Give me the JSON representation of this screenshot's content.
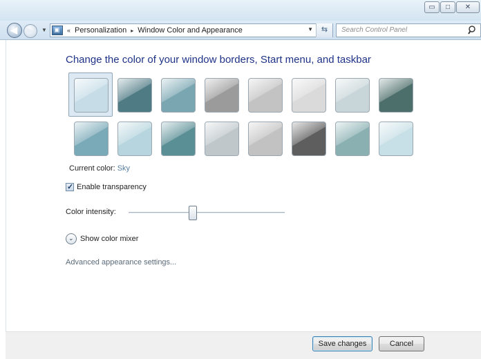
{
  "window": {
    "caption_buttons": {
      "minimize": "minimize-icon",
      "maximize": "maximize-icon",
      "close": "close-icon"
    }
  },
  "navbar": {
    "address": {
      "icon": "control-panel-icon",
      "overflow_glyph": "«",
      "separator_glyph": "▸",
      "breadcrumbs": [
        "Personalization",
        "Window Color and Appearance"
      ]
    },
    "search": {
      "placeholder": "Search Control Panel"
    }
  },
  "main": {
    "heading": "Change the color of your window borders, Start menu, and taskbar",
    "swatches": [
      [
        "#c6dde8",
        "#4f7b85",
        "#7aa6b2",
        "#9b9b9b",
        "#c3c3c3",
        "#dadada",
        "#c9d6d9",
        "#4d6f6b"
      ],
      [
        "#7aa9b8",
        "#b6d5de",
        "#5a8f96",
        "#bfc7cb",
        "#c2c2c2",
        "#5e5e5e",
        "#8ab0b2",
        "#c7dfe6"
      ]
    ],
    "selected_swatch": {
      "row": 0,
      "col": 0
    },
    "current_color": {
      "label": "Current color:",
      "value": "Sky"
    },
    "transparency": {
      "label": "Enable transparency",
      "checked": true
    },
    "intensity": {
      "label": "Color intensity:",
      "value_fraction": 0.41
    },
    "mixer": {
      "label": "Show color mixer"
    },
    "advanced_link": "Advanced appearance settings..."
  },
  "footer": {
    "save_label": "Save changes",
    "cancel_label": "Cancel"
  }
}
